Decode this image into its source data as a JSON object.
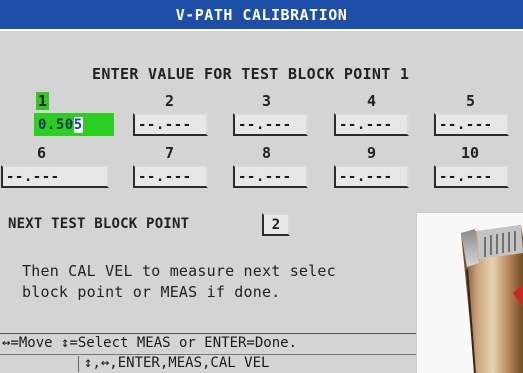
{
  "title": "V-PATH CALIBRATION",
  "prompt": "ENTER VALUE FOR TEST BLOCK POINT 1",
  "points": [
    {
      "num": "1",
      "value_main": "0.50",
      "value_cursor": "5",
      "active": true
    },
    {
      "num": "2",
      "value": "--.---"
    },
    {
      "num": "3",
      "value": "--.---"
    },
    {
      "num": "4",
      "value": "--.---"
    },
    {
      "num": "5",
      "value": "--.---"
    },
    {
      "num": "6",
      "value": "--.---"
    },
    {
      "num": "7",
      "value": "--.---"
    },
    {
      "num": "8",
      "value": "--.---"
    },
    {
      "num": "9",
      "value": "--.---"
    },
    {
      "num": "10",
      "value": "--.---"
    }
  ],
  "next_point": {
    "label": "NEXT TEST BLOCK POINT",
    "value": "2"
  },
  "instructions": {
    "line1": "Then CAL VEL to measure next selec",
    "line2": "block point or MEAS if done."
  },
  "help": {
    "line1": "↔=Move ↕=Select MEAS or ENTER=Done.",
    "line2": "↕,↔,ENTER,MEAS,CAL VEL"
  },
  "colors": {
    "title_bar": "#1e4fa8",
    "active_green": "#2bcf22",
    "screen_bg": "#d4d4d4"
  }
}
